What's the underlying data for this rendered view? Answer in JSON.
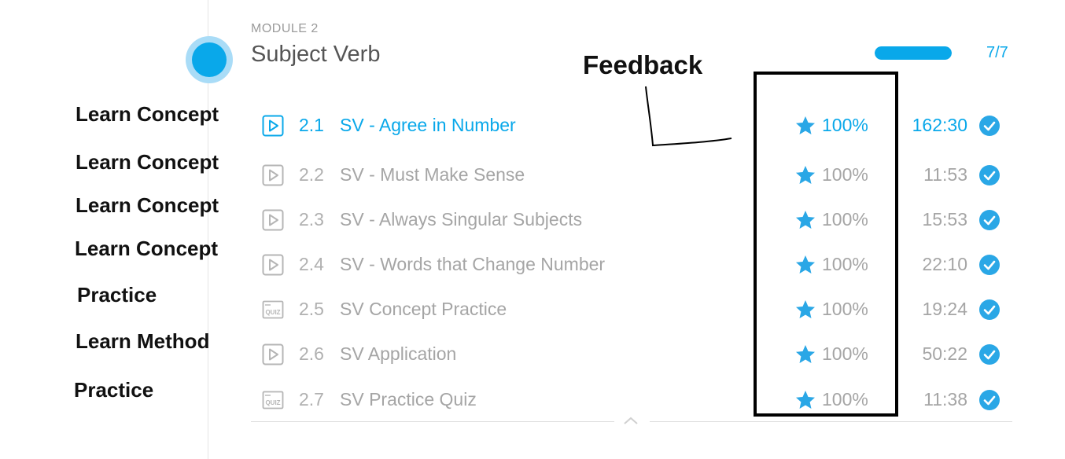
{
  "module": {
    "label": "MODULE 2",
    "title": "Subject Verb",
    "progress_fraction": 1.0,
    "progress_text": "7/7"
  },
  "annotation": {
    "feedback_label": "Feedback"
  },
  "colors": {
    "accent": "#09a8ea",
    "muted_text": "#a5a5a5",
    "star": "#2aa7e6",
    "check": "#2aa7e6"
  },
  "lessons": [
    {
      "type": "Learn Concept",
      "icon": "video-play-icon",
      "number": "2.1",
      "title": "SV - Agree in Number",
      "score": "100%",
      "time": "162:30",
      "active": true
    },
    {
      "type": "Learn Concept",
      "icon": "video-play-icon",
      "number": "2.2",
      "title": "SV - Must Make Sense",
      "score": "100%",
      "time": "11:53",
      "active": false
    },
    {
      "type": "Learn Concept",
      "icon": "video-play-icon",
      "number": "2.3",
      "title": "SV - Always Singular Subjects",
      "score": "100%",
      "time": "15:53",
      "active": false
    },
    {
      "type": "Learn Concept",
      "icon": "video-play-icon",
      "number": "2.4",
      "title": "SV - Words that Change Number",
      "score": "100%",
      "time": "22:10",
      "active": false
    },
    {
      "type": "Practice",
      "icon": "quiz-icon",
      "number": "2.5",
      "title": "SV Concept Practice",
      "score": "100%",
      "time": "19:24",
      "active": false
    },
    {
      "type": "Learn Method",
      "icon": "video-play-icon",
      "number": "2.6",
      "title": "SV Application",
      "score": "100%",
      "time": "50:22",
      "active": false
    },
    {
      "type": "Practice",
      "icon": "quiz-icon",
      "number": "2.7",
      "title": "SV Practice Quiz",
      "score": "100%",
      "time": "11:38",
      "active": false
    }
  ],
  "quiz_icon_text": "QUIZ"
}
